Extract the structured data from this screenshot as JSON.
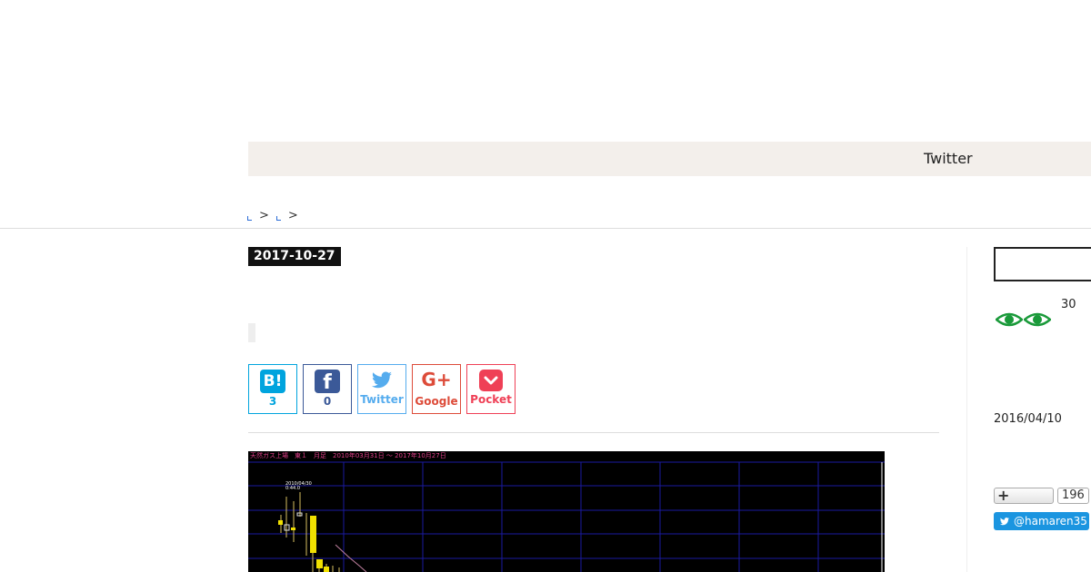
{
  "header": {
    "nav_twitter": "Twitter"
  },
  "breadcrumb": {
    "sep1": ">",
    "sep2": ">"
  },
  "post": {
    "date": "2017-10-27",
    "share": {
      "hatena_icon": "B!",
      "hatena_count": "3",
      "facebook_icon": "f",
      "facebook_count": "0",
      "twitter_label": "Twitter",
      "google_icon": "G+",
      "google_label": "Google",
      "pocket_label": "Pocket"
    },
    "chart_image": {
      "title_text": "天然ガス上場　東１　月足　2010年03月31日 ～ 2017年10月27日",
      "annotation_date": "2010/04/30",
      "annotation_value": "0:44.0"
    }
  },
  "sidebar": {
    "eye_count": "30",
    "date": "2016/04/10",
    "follow_count": "196",
    "twitter_handle": "@hamaren35"
  },
  "colors": {
    "nav_bg": "#f3efeb",
    "hatena": "#00a4de",
    "facebook": "#3b5998",
    "twitter": "#55acee",
    "google": "#dd4b39",
    "pocket": "#ef4056",
    "eye_green": "#1a9a3a",
    "twitter_follow": "#1b95e0"
  }
}
